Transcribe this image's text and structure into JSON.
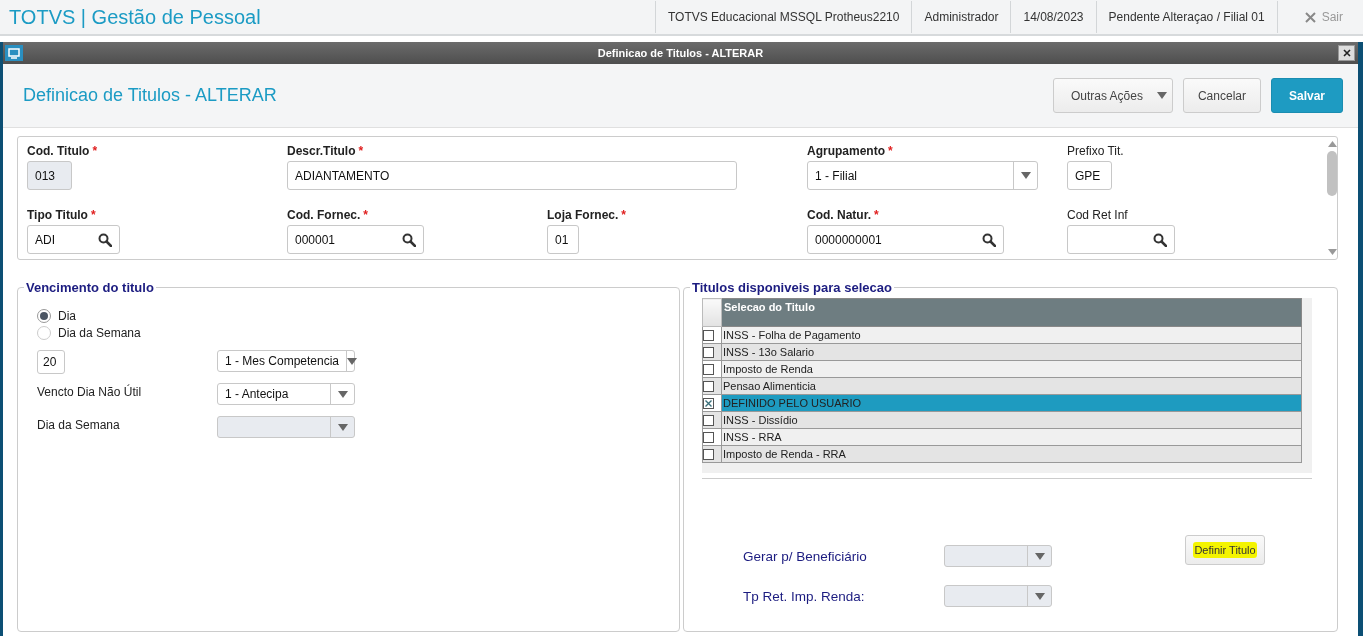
{
  "app": {
    "title": "TOTVS | Gestão de Pessoal",
    "status": [
      "TOTVS Educacional MSSQL Protheus2210",
      "Administrador",
      "14/08/2023",
      "Pendente Alteraçao / Filial 01"
    ],
    "exit": "Sair"
  },
  "dialog": {
    "title": "Definicao de Titulos - ALTERAR",
    "heading": "Definicao de Titulos - ALTERAR",
    "buttons": [
      {
        "label": "Outras Ações",
        "kind": "menu"
      },
      {
        "label": "Cancelar",
        "kind": "default"
      },
      {
        "label": "Salvar",
        "kind": "primary"
      }
    ]
  },
  "form": {
    "fields": [
      {
        "label": "Cod. Titulo",
        "required": true,
        "mark": "*",
        "value": "013",
        "kind": "text",
        "disabled": true
      },
      {
        "label": "Descr.Titulo",
        "required": true,
        "mark": "*",
        "value": "ADIANTAMENTO",
        "kind": "text",
        "disabled": false
      },
      {
        "label": "Agrupamento",
        "required": true,
        "mark": "*",
        "value": "1 - Filial",
        "kind": "select",
        "disabled": false
      },
      {
        "label": "Prefixo Tit.",
        "required": false,
        "value": "GPE",
        "kind": "text",
        "disabled": false
      },
      {
        "label": "Tipo Titulo",
        "required": true,
        "mark": "*",
        "value": "ADI",
        "kind": "lookup",
        "disabled": false
      },
      {
        "label": "Cod. Fornec.",
        "required": true,
        "mark": "*",
        "value": "000001",
        "kind": "lookup",
        "disabled": false
      },
      {
        "label": "Loja Fornec.",
        "required": true,
        "mark": "*",
        "value": "01",
        "kind": "text",
        "disabled": false
      },
      {
        "label": "Cod. Natur.",
        "required": true,
        "mark": "*",
        "value": "0000000001",
        "kind": "lookup",
        "disabled": false
      },
      {
        "label": "Cod Ret Inf",
        "required": false,
        "kind": "lookup",
        "disabled": false
      }
    ]
  },
  "due": {
    "legend": "Vencimento do titulo",
    "options": [
      {
        "label": "Dia",
        "selected": true
      },
      {
        "label": "Dia da Semana",
        "selected": false
      }
    ],
    "day": "20",
    "month": "1 - Mes Competencia",
    "settings": [
      {
        "label": "Vencto Dia Não Útil",
        "value": "1 - Antecipa",
        "disabled": false
      },
      {
        "label": "Dia da Semana",
        "disabled": true
      }
    ]
  },
  "titles": {
    "legend": "Titulos disponiveis para selecao",
    "column": "Selecao do Titulo",
    "rows": [
      {
        "label": "INSS - Folha de Pagamento",
        "checked": false,
        "selected": false
      },
      {
        "label": "INSS - 13o Salario",
        "checked": false,
        "selected": false
      },
      {
        "label": "Imposto de Renda",
        "checked": false,
        "selected": false
      },
      {
        "label": "Pensao Alimenticia",
        "checked": false,
        "selected": false
      },
      {
        "label": "DEFINIDO PELO USUARIO",
        "checked": true,
        "selected": true
      },
      {
        "label": "INSS - Dissídio",
        "checked": false,
        "selected": false
      },
      {
        "label": "INSS - RRA",
        "checked": false,
        "selected": false
      },
      {
        "label": "Imposto de Renda - RRA",
        "checked": false,
        "selected": false
      }
    ],
    "options": [
      {
        "label": "Gerar p/ Beneficiário",
        "disabled": true
      },
      {
        "label": "Tp Ret. Imp. Renda:",
        "disabled": true
      }
    ],
    "action": {
      "label": "Definir Titulo",
      "highlighted": true
    }
  }
}
